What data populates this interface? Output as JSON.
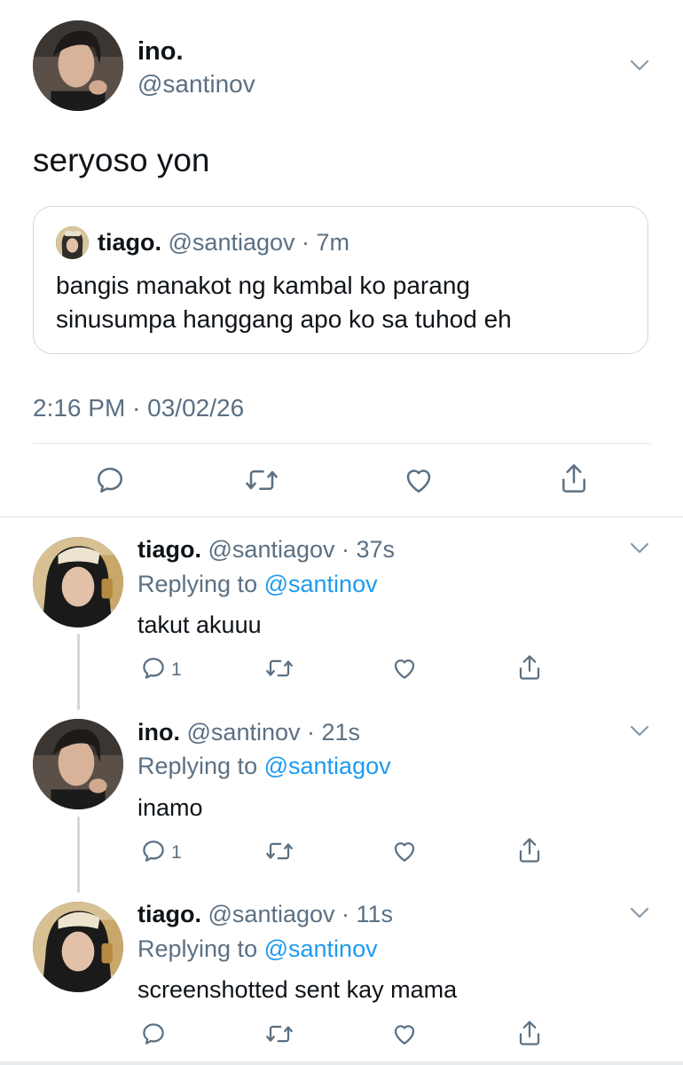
{
  "main_tweet": {
    "display_name": "ino.",
    "handle": "@santinov",
    "text": "seryoso yon",
    "timestamp": "2:16 PM · 03/02/26",
    "quote": {
      "display_name": "tiago.",
      "handle": "@santiagov",
      "time": "· 7m",
      "text_line1": "bangis manakot ng kambal ko parang",
      "text_line2": "sinusumpa hanggang apo ko sa tuhod eh"
    }
  },
  "replies": [
    {
      "display_name": "tiago.",
      "handle": "@santiagov",
      "time": "· 37s",
      "replying_prefix": "Replying to",
      "replying_to": "@santinov",
      "text": "takut akuuu",
      "reply_count": "1"
    },
    {
      "display_name": "ino.",
      "handle": "@santinov",
      "time": "· 21s",
      "replying_prefix": "Replying to",
      "replying_to": "@santiagov",
      "text": "inamo",
      "reply_count": "1"
    },
    {
      "display_name": "tiago.",
      "handle": "@santiagov",
      "time": "· 11s",
      "replying_prefix": "Replying to",
      "replying_to": "@santinov",
      "text": "screenshotted sent kay mama",
      "reply_count": ""
    }
  ],
  "colors": {
    "accent": "#1d9bf0",
    "muted_text": "#5b7083",
    "divider": "#e1e8ed",
    "background": "#ffffff"
  },
  "icons": [
    "reply-icon",
    "retweet-icon",
    "like-icon",
    "share-icon",
    "chevron-down-icon"
  ]
}
